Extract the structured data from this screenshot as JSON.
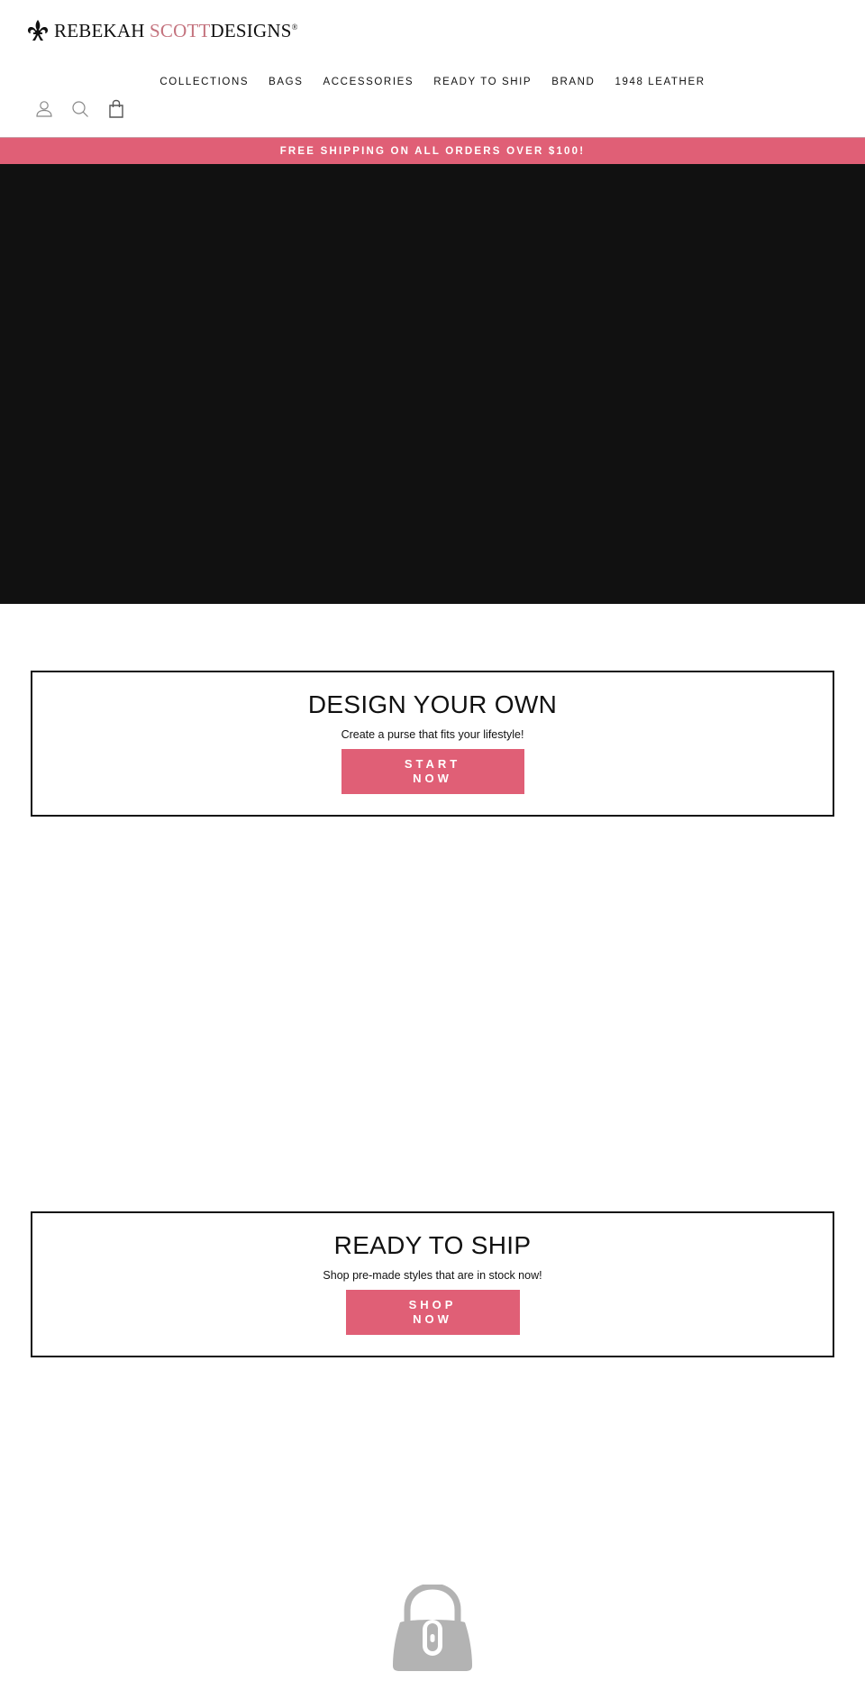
{
  "brand": {
    "name_part1": "REBEKAH ",
    "name_accent": "SCOTT",
    "name_part2": "DESIGNS",
    "registered": "®",
    "logo_icon": "fleur-de-lis-icon",
    "accent_color": "#c4737e"
  },
  "nav": {
    "items": [
      {
        "label": "COLLECTIONS"
      },
      {
        "label": "BAGS"
      },
      {
        "label": "ACCESSORIES"
      },
      {
        "label": "READY TO SHIP"
      },
      {
        "label": "BRAND"
      },
      {
        "label": "1948 LEATHER"
      }
    ]
  },
  "header_icons": [
    "account-icon",
    "search-icon",
    "cart-icon"
  ],
  "announcement": {
    "text": "FREE SHIPPING ON ALL ORDERS OVER $100!",
    "background": "#e05f76"
  },
  "hero": {
    "background": "#111111"
  },
  "promos": [
    {
      "title": "DESIGN YOUR OWN",
      "subtitle": "Create a purse that fits your lifestyle!",
      "button_line1": "START",
      "button_line2": "NOW"
    },
    {
      "title": "READY TO SHIP",
      "subtitle": "Shop pre-made styles that are in stock now!",
      "button_line1": "SHOP",
      "button_line2": "NOW"
    }
  ],
  "placeholder_icon": "handbag-icon",
  "colors": {
    "button": "#e05f76",
    "placeholder_gray": "#b3b3b3"
  }
}
